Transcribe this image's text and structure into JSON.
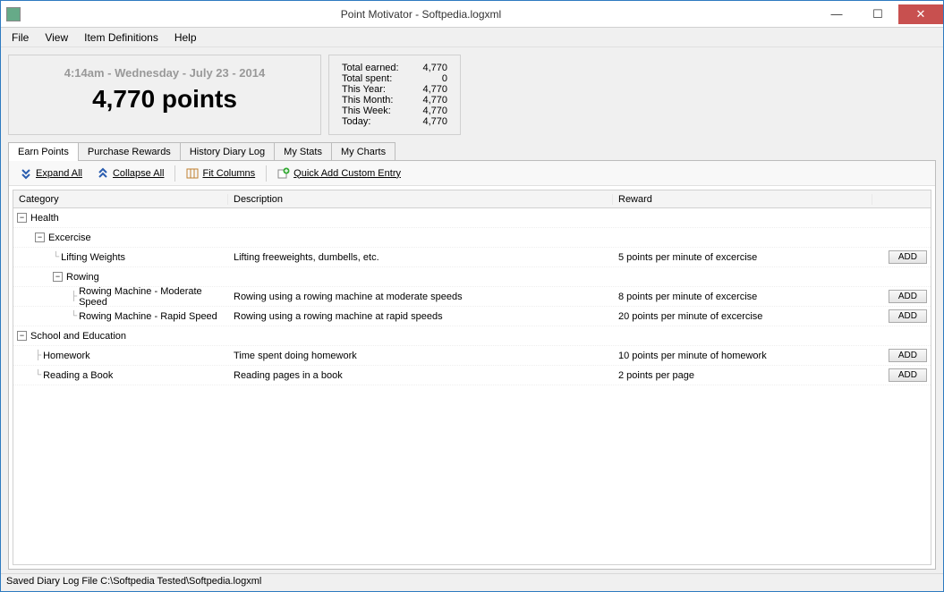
{
  "window": {
    "title": "Point Motivator - Softpedia.logxml"
  },
  "menu": {
    "file": "File",
    "view": "View",
    "item_defs": "Item Definitions",
    "help": "Help"
  },
  "points_panel": {
    "datetime": "4:14am - Wednesday - July 23 - 2014",
    "big": "4,770 points"
  },
  "stats": {
    "rows": [
      {
        "label": "Total earned:",
        "value": "4,770"
      },
      {
        "label": "Total spent:",
        "value": "0"
      },
      {
        "label": "This Year:",
        "value": "4,770"
      },
      {
        "label": "This Month:",
        "value": "4,770"
      },
      {
        "label": "This Week:",
        "value": "4,770"
      },
      {
        "label": "Today:",
        "value": "4,770"
      }
    ]
  },
  "tabs": {
    "earn": "Earn Points",
    "purchase": "Purchase Rewards",
    "history": "History Diary Log",
    "stats": "My Stats",
    "charts": "My Charts"
  },
  "toolbar": {
    "expand": "Expand All",
    "collapse": "Collapse All",
    "fit": "Fit Columns",
    "quick": "Quick Add Custom Entry"
  },
  "columns": {
    "category": "Category",
    "description": "Description",
    "reward": "Reward"
  },
  "tree": {
    "add_label": "ADD",
    "health": "Health",
    "excercise": "Excercise",
    "lifting": {
      "name": "Lifting Weights",
      "desc": "Lifting freeweights, dumbells, etc.",
      "reward": "5 points per minute of excercise"
    },
    "rowing": "Rowing",
    "row_mod": {
      "name": "Rowing Machine - Moderate Speed",
      "desc": "Rowing using a rowing machine at moderate speeds",
      "reward": "8 points per minute of excercise"
    },
    "row_rapid": {
      "name": "Rowing Machine - Rapid Speed",
      "desc": "Rowing using a rowing machine at rapid speeds",
      "reward": "20 points per minute of excercise"
    },
    "school": "School and Education",
    "homework": {
      "name": "Homework",
      "desc": "Time spent doing homework",
      "reward": "10 points per minute of homework"
    },
    "reading": {
      "name": "Reading a Book",
      "desc": "Reading pages in a book",
      "reward": "2 points per page"
    }
  },
  "status": "Saved Diary Log File C:\\Softpedia Tested\\Softpedia.logxml"
}
